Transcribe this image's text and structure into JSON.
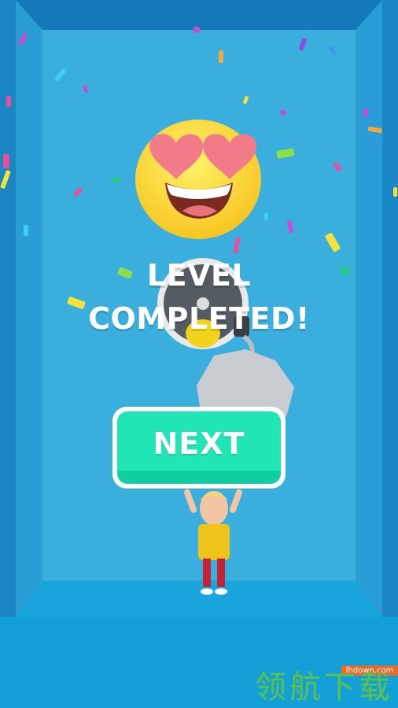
{
  "game": {
    "title_line1": "LEVEL",
    "title_line2": "COMPLETED!",
    "next_label": "NEXT",
    "emoji": "heart-eyes-face-icon"
  },
  "watermark": {
    "url": "lhdown.com",
    "text": "领航下载"
  },
  "colors": {
    "background": "#3aaedc",
    "frame": "#1a86c3",
    "floor": "#13a0d6",
    "button": "#1fe6b4",
    "button_border": "#ffffff",
    "text": "#ffffff"
  }
}
